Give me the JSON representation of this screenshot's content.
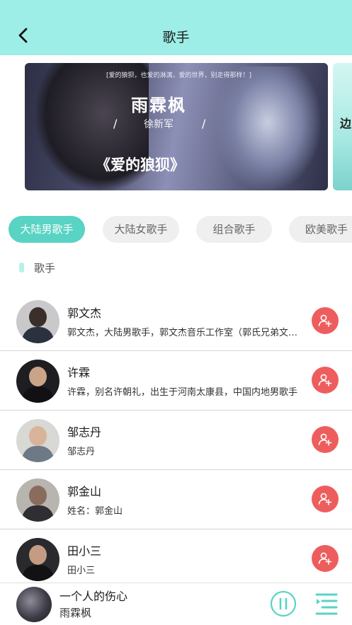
{
  "header": {
    "title": "歌手",
    "back_icon": "chevron-left-icon"
  },
  "banner": {
    "top_line": "[爱的狼狈，也爱的淋漓，爱的世界，别走得那样！]",
    "artist": "雨霖枫",
    "featuring": "徐新军",
    "slash": "/",
    "song": "《爱的狼狈》",
    "next_peek_text": "边"
  },
  "tabs": [
    {
      "label": "大陆男歌手",
      "active": true
    },
    {
      "label": "大陆女歌手",
      "active": false
    },
    {
      "label": "组合歌手",
      "active": false
    },
    {
      "label": "欧美歌手",
      "active": false
    }
  ],
  "section": {
    "label": "歌手"
  },
  "singers": [
    {
      "name": "郭文杰",
      "desc": "郭文杰，大陆男歌手，郭文杰音乐工作室（郭氏兄弟文化传媒）",
      "follow_icon": "add-user-icon"
    },
    {
      "name": "许霖",
      "desc": "许霖，别名许朝礼，出生于河南太康县，中国内地男歌手",
      "follow_icon": "add-user-icon"
    },
    {
      "name": "邹志丹",
      "desc": "邹志丹",
      "follow_icon": "add-user-icon"
    },
    {
      "name": "郭金山",
      "desc": "姓名：郭金山",
      "follow_icon": "add-user-icon"
    },
    {
      "name": "田小三",
      "desc": "田小三",
      "follow_icon": "add-user-icon"
    }
  ],
  "player": {
    "title": "一个人的伤心",
    "artist": "雨霖枫",
    "pause_icon": "pause-circle-icon",
    "playlist_icon": "playlist-icon"
  },
  "colors": {
    "header_bg": "#9deee6",
    "accent": "#59d3c3",
    "follow_button": "#ee5d5d"
  }
}
